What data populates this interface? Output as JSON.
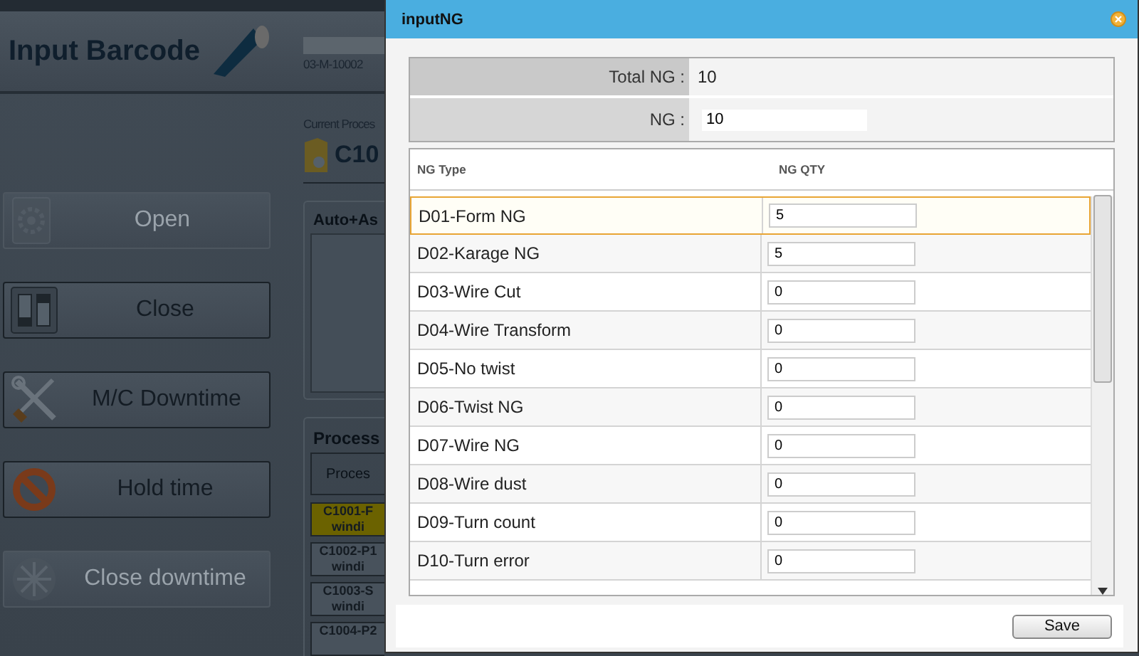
{
  "app": {
    "title": "Input Barcode",
    "barcode_text": "03-M-10002",
    "current_process_label": "Current Proces",
    "current_process": "C10",
    "buttons": [
      {
        "label": "Open",
        "kind": "gear",
        "disabled": true
      },
      {
        "label": "Close",
        "kind": "switch",
        "disabled": false
      },
      {
        "label": "M/C Downtime",
        "kind": "tools",
        "disabled": false
      },
      {
        "label": "Hold time",
        "kind": "stop",
        "disabled": false
      },
      {
        "label": "Close downtime",
        "kind": "wheel",
        "disabled": true
      }
    ],
    "auto_panel": {
      "title": "Auto+As"
    },
    "process_panel": {
      "title": "Process",
      "column": "Proces",
      "items": [
        {
          "line_1": "C1001-F",
          "line_2": "windi",
          "selected": true
        },
        {
          "line_1": "C1002-P1",
          "line_2": "windi",
          "selected": false
        },
        {
          "line_1": "C1003-S",
          "line_2": "windi",
          "selected": false
        },
        {
          "line_1": "C1004-P2",
          "selected": false
        }
      ]
    }
  },
  "dialog": {
    "title": "inputNG",
    "total_label": "Total NG :",
    "total_value": "10",
    "ng_label": "NG :",
    "ng_value": "10",
    "columns": [
      "NG Type",
      "NG QTY"
    ],
    "rows": [
      {
        "type": "D01-Form NG",
        "qty": "5",
        "selected": true
      },
      {
        "type": "D02-Karage NG",
        "qty": "5",
        "selected": false
      },
      {
        "type": "D03-Wire Cut",
        "qty": "0",
        "selected": false
      },
      {
        "type": "D04-Wire Transform",
        "qty": "0",
        "selected": false
      },
      {
        "type": "D05-No twist",
        "qty": "0",
        "selected": false
      },
      {
        "type": "D06-Twist NG",
        "qty": "0",
        "selected": false
      },
      {
        "type": "D07-Wire NG",
        "qty": "0",
        "selected": false
      },
      {
        "type": "D08-Wire dust",
        "qty": "0",
        "selected": false
      },
      {
        "type": "D09-Turn count",
        "qty": "0",
        "selected": false
      },
      {
        "type": "D10-Turn error",
        "qty": "0",
        "selected": false
      }
    ],
    "save": "Save"
  }
}
